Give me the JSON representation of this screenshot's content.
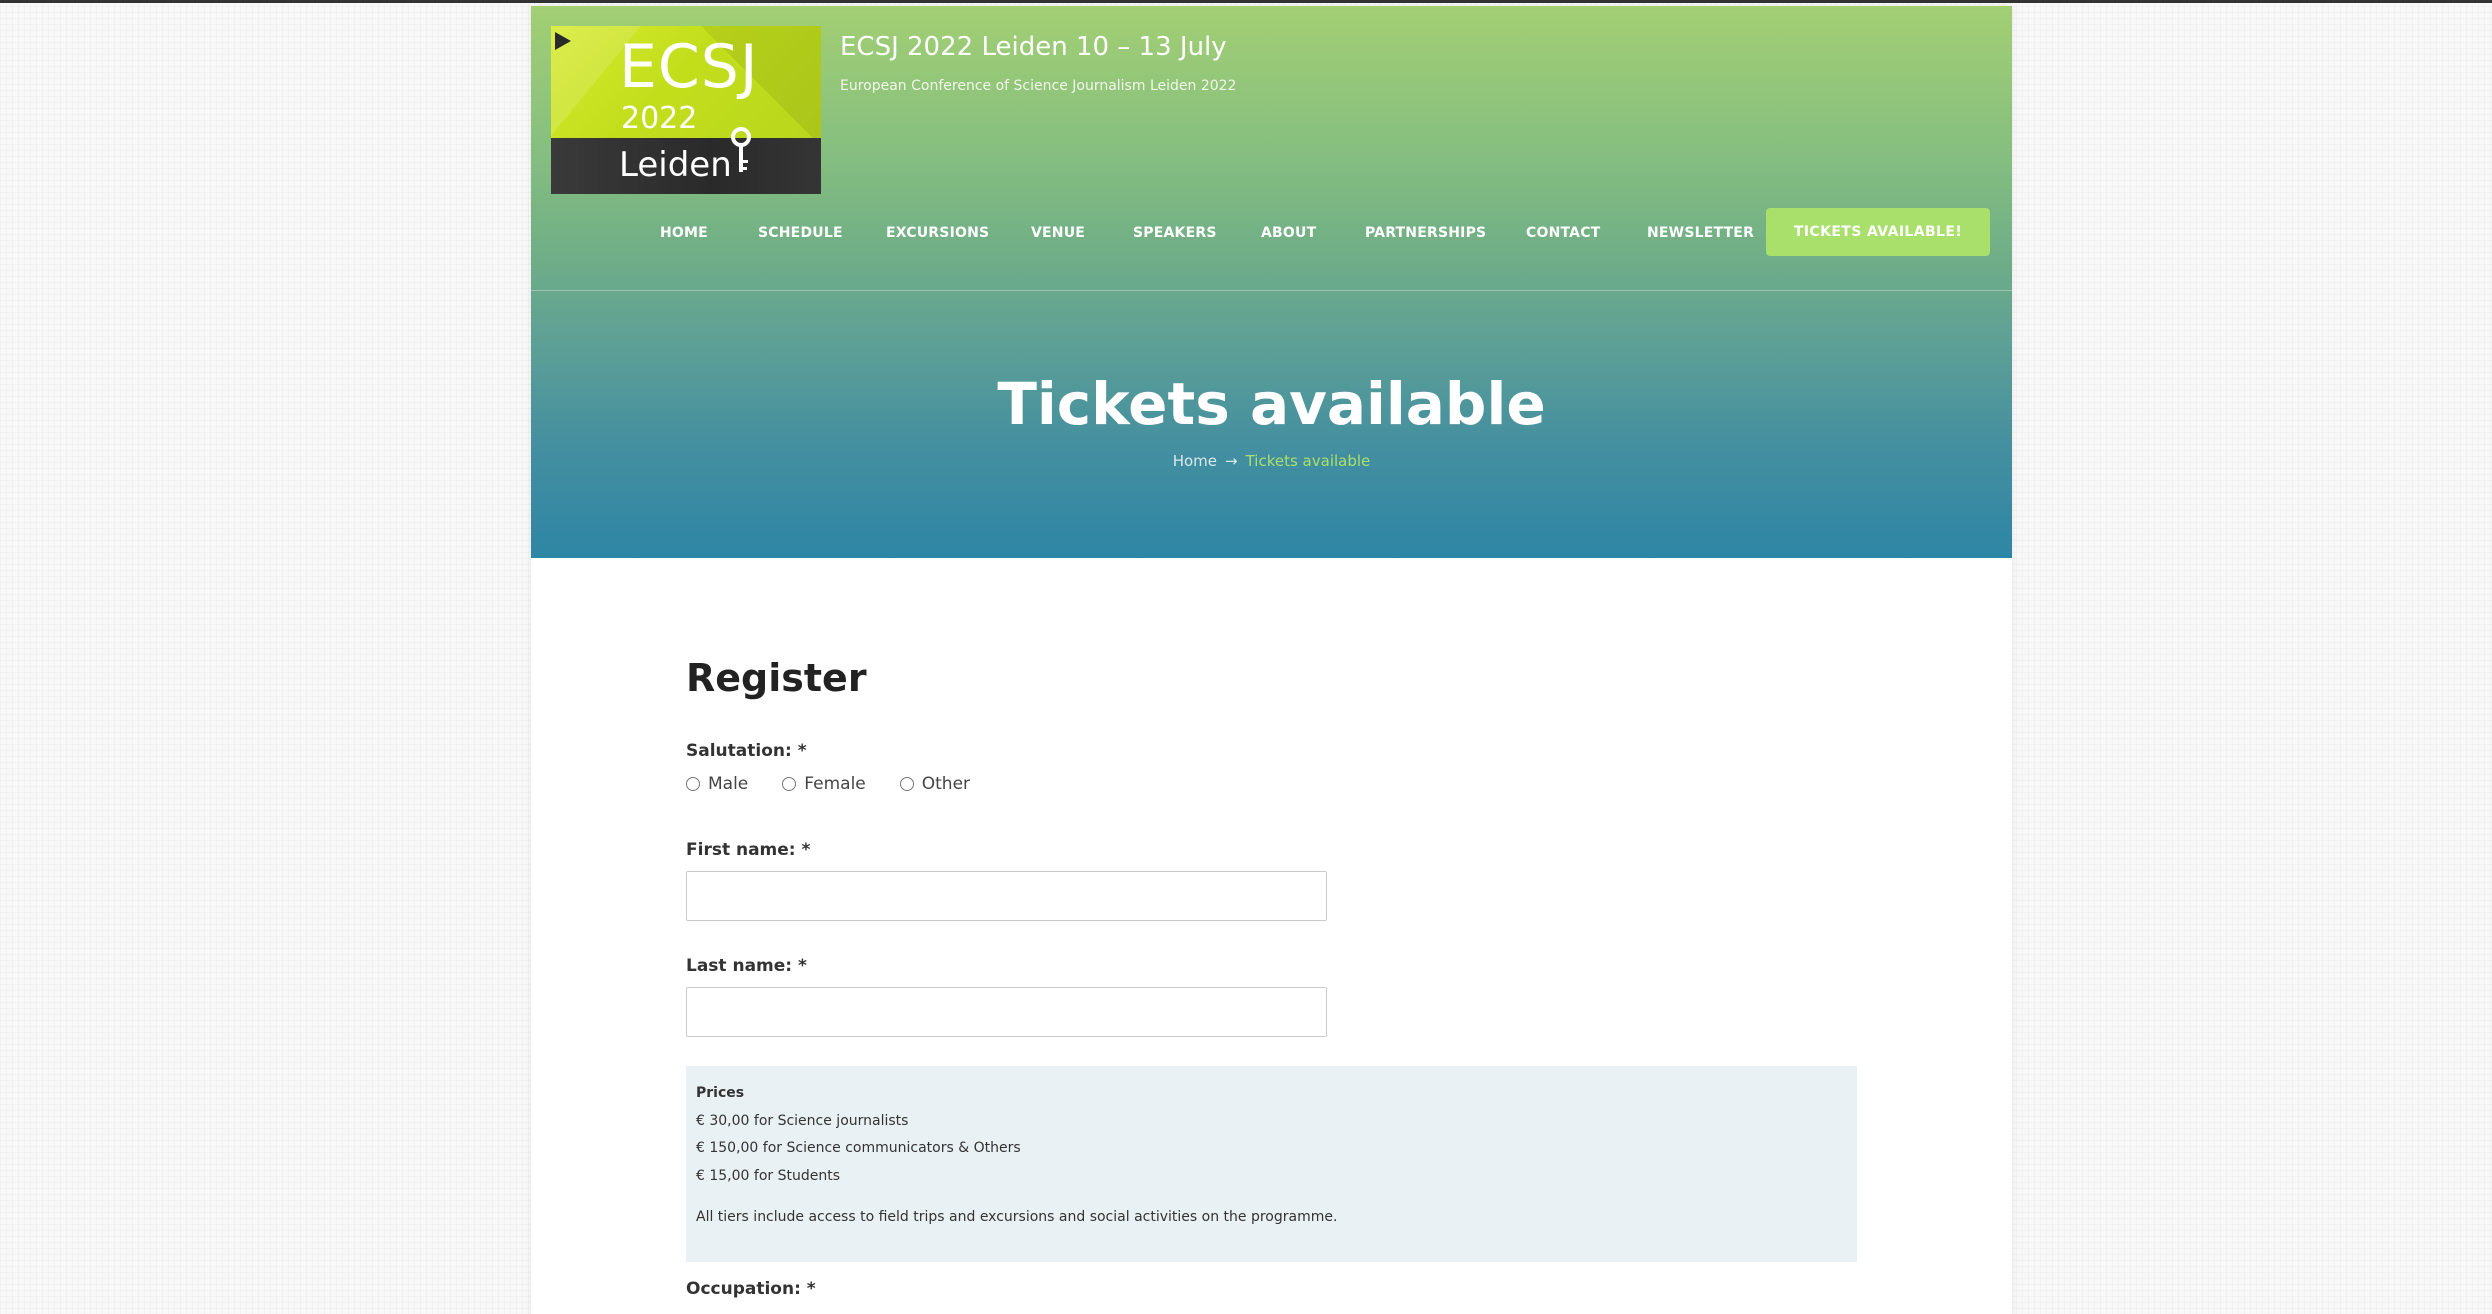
{
  "site": {
    "title": "ECSJ 2022 Leiden 10 – 13 July",
    "tagline": "European Conference of Science Journalism Leiden 2022",
    "logo": {
      "line1": "ECSJ",
      "line2": "2022",
      "line3": "Leiden",
      "accent": "#c2de1b"
    }
  },
  "nav": {
    "items": [
      "HOME",
      "SCHEDULE",
      "EXCURSIONS",
      "VENUE",
      "SPEAKERS",
      "ABOUT",
      "PARTNERSHIPS",
      "CONTACT",
      "NEWSLETTER"
    ],
    "cta": "TICKETS AVAILABLE!",
    "cta_color": "#a8e06b"
  },
  "hero": {
    "title": "Tickets available",
    "breadcrumb": {
      "home": "Home",
      "separator": "→",
      "current": "Tickets available"
    }
  },
  "form": {
    "heading": "Register",
    "salutation_label": "Salutation: *",
    "salutation_options": [
      "Male",
      "Female",
      "Other"
    ],
    "first_name_label": "First name: *",
    "first_name_value": "",
    "last_name_label": "Last name: *",
    "last_name_value": "",
    "prices": {
      "title": "Prices",
      "lines": [
        "€ 30,00 for Science journalists",
        "€ 150,00 for Science communicators & Others",
        "€ 15,00 for Students"
      ],
      "note": "All tiers include access to field trips and excursions and social activities on the programme."
    },
    "occupation_label": "Occupation: *"
  }
}
